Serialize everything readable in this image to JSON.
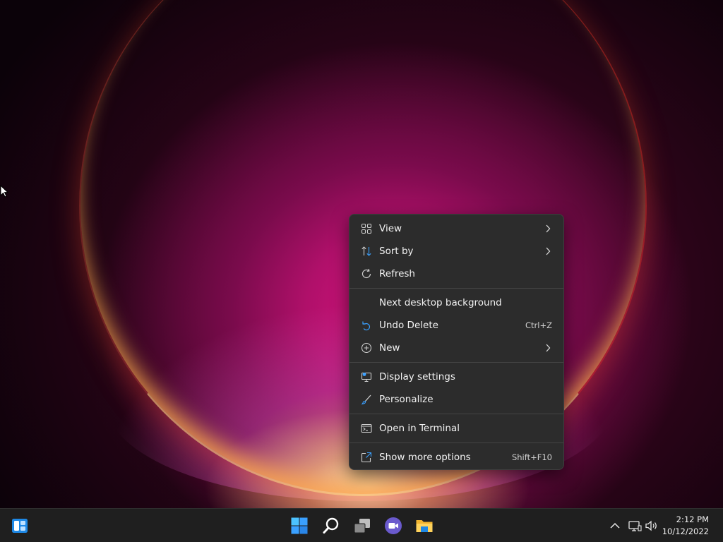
{
  "context_menu": {
    "items": [
      {
        "label": "View",
        "icon": "view-grid-icon",
        "submenu": true
      },
      {
        "label": "Sort by",
        "icon": "sort-icon",
        "submenu": true
      },
      {
        "label": "Refresh",
        "icon": "refresh-icon"
      },
      {
        "label": "Next desktop background"
      },
      {
        "label": "Undo Delete",
        "icon": "undo-icon",
        "shortcut": "Ctrl+Z"
      },
      {
        "label": "New",
        "icon": "new-plus-icon",
        "submenu": true
      },
      {
        "label": "Display settings",
        "icon": "display-icon"
      },
      {
        "label": "Personalize",
        "icon": "brush-icon"
      },
      {
        "label": "Open in Terminal",
        "icon": "terminal-icon"
      },
      {
        "label": "Show more options",
        "icon": "share-icon",
        "shortcut": "Shift+F10"
      }
    ]
  },
  "taskbar": {
    "icons": [
      "widgets-icon",
      "start-icon",
      "search-icon",
      "task-view-icon",
      "teams-chat-icon",
      "file-explorer-icon"
    ],
    "tray_icons": [
      "chevron-up-icon",
      "network-icon",
      "volume-icon"
    ],
    "clock": {
      "time": "2:12 PM",
      "date": "10/12/2022"
    }
  },
  "colors": {
    "menu_bg": "#2c2c2c",
    "taskbar_bg": "#1f1f1f",
    "accent_blue": "#3aa0ff",
    "wallpaper_magenta": "#d6157e"
  }
}
